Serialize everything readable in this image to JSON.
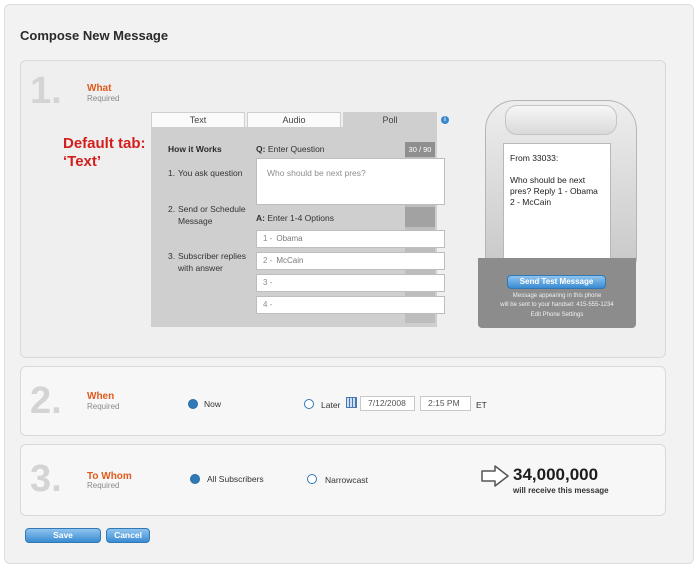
{
  "page_title": "Compose New Message",
  "annotation": {
    "line1": "Default tab:",
    "line2": "‘Text’"
  },
  "steps": [
    {
      "num": "1.",
      "title": "What",
      "required": "Required"
    },
    {
      "num": "2.",
      "title": "When",
      "required": "Required"
    },
    {
      "num": "3.",
      "title": "To Whom",
      "required": "Required"
    }
  ],
  "tabs": [
    {
      "label": "Text"
    },
    {
      "label": "Audio"
    },
    {
      "label": "Poll"
    }
  ],
  "info_icon": "i",
  "how_it_works": {
    "title": "How it Works",
    "steps": [
      {
        "n": "1.",
        "text": "You ask question"
      },
      {
        "n": "2.",
        "text": "Send or Schedule Message"
      },
      {
        "n": "3.",
        "text": "Subscriber replies with answer"
      }
    ]
  },
  "question": {
    "prefix": "Q:",
    "label": "Enter Question",
    "placeholder": "Who should be next pres?",
    "counter": "30 / 90"
  },
  "answers": {
    "prefix": "A:",
    "label": "Enter 1-4 Options",
    "options": [
      {
        "num": "1 -",
        "value": "Obama"
      },
      {
        "num": "2 -",
        "value": "McCain"
      },
      {
        "num": "3 -",
        "value": ""
      },
      {
        "num": "4 -",
        "value": ""
      }
    ]
  },
  "phone": {
    "from": "From 33033:",
    "message": "Who should be next pres? Reply 1 - Obama 2 - McCain",
    "send_button": "Send Test Message",
    "note_line1": "Message appearing in this phone",
    "note_line2": "will be sent to your handset: 415-555-1234",
    "edit_link": "Edit Phone Settings"
  },
  "when": {
    "now": "Now",
    "later": "Later",
    "date": "7/12/2008",
    "time": "2:15 PM",
    "tz": "ET"
  },
  "whom": {
    "all": "All Subscribers",
    "narrow": "Narrowcast",
    "count": "34,000,000",
    "count_sub": "will receive this message"
  },
  "buttons": {
    "save": "Save",
    "cancel": "Cancel"
  },
  "colors": {
    "accent_orange": "#e05a1c",
    "button_blue": "#3a8cd2",
    "annotation_red": "#d41e1e"
  }
}
